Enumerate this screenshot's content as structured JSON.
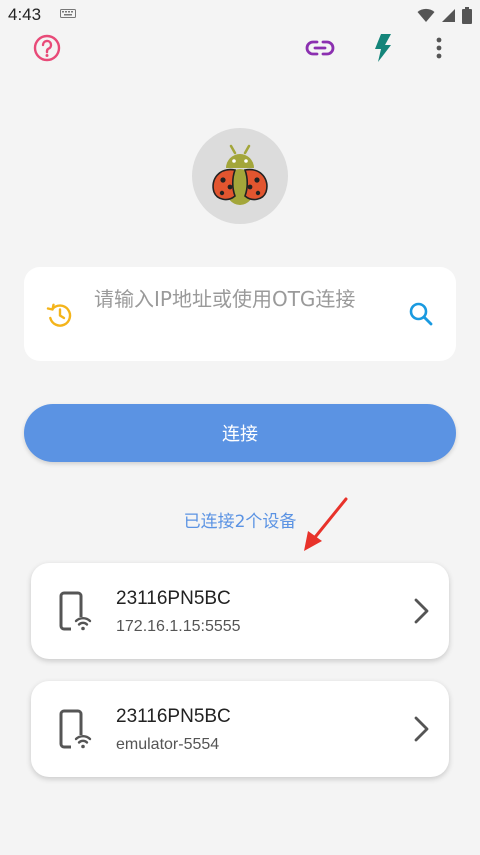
{
  "status_bar": {
    "time": "4:43",
    "icons": [
      "keyboard-icon",
      "wifi-icon",
      "cell-signal-icon",
      "battery-icon"
    ]
  },
  "toolbar": {
    "icons": [
      "help-icon",
      "link-icon",
      "flash-icon",
      "more-vert-icon"
    ],
    "colors": {
      "help": "#e84a78",
      "link": "#8b2fb0",
      "flash": "#14857a",
      "more": "#555555"
    }
  },
  "logo": {
    "icon": "ladybug-android-icon"
  },
  "search": {
    "placeholder": "请输入IP地址或使用OTG连接",
    "value": "",
    "history_icon_color": "#f4b41a",
    "search_icon_color": "#1a9ae0"
  },
  "connect_button": {
    "label": "连接",
    "color": "#5b93e3"
  },
  "connected_summary": "已连接2个设备",
  "devices": [
    {
      "name": "23116PN5BC",
      "address": "172.16.1.15:5555"
    },
    {
      "name": "23116PN5BC",
      "address": "emulator-5554"
    }
  ]
}
